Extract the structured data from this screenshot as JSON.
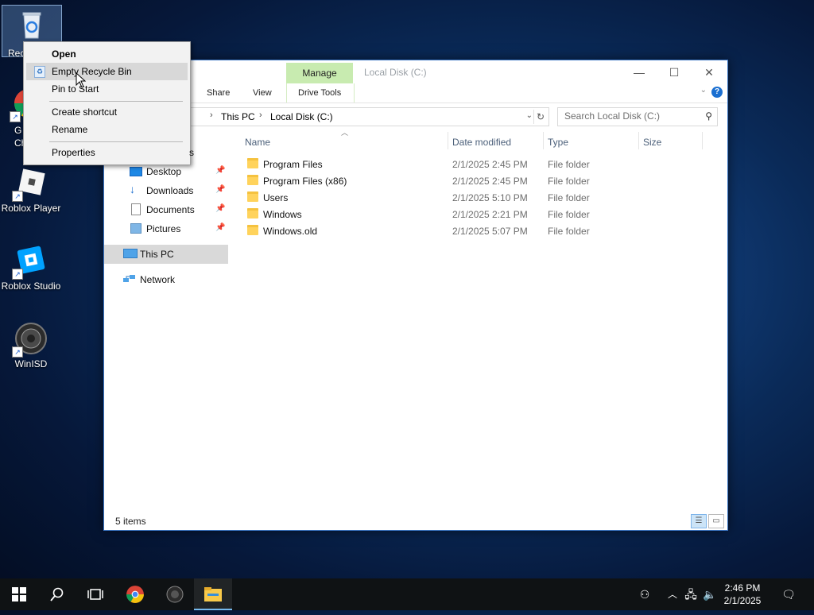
{
  "desktop": {
    "icons": [
      {
        "label": "Rec",
        "icon": "recycle-bin-icon"
      },
      {
        "label": "G\nCh",
        "icon": "chrome-icon"
      },
      {
        "label": "Roblox Player",
        "icon": "roblox-player-icon"
      },
      {
        "label": "Roblox Studio",
        "icon": "roblox-studio-icon"
      },
      {
        "label": "WinISD",
        "icon": "speaker-icon"
      }
    ]
  },
  "context_menu": {
    "items": [
      {
        "label": "Open",
        "bold": true
      },
      {
        "label": "Empty Recycle Bin",
        "hovered": true,
        "icon": "recycle-shield-icon"
      },
      {
        "label": "Pin to Start"
      },
      {
        "label": "Create shortcut"
      },
      {
        "label": "Rename"
      },
      {
        "label": "Properties"
      }
    ],
    "partial_hidden_text": "s"
  },
  "window": {
    "title": "Local Disk (C:)",
    "context_tab": "Manage",
    "ribbon_tabs": [
      "Share",
      "View",
      "Drive Tools"
    ],
    "address": {
      "root": "This PC",
      "current": "Local Disk (C:)"
    },
    "search_placeholder": "Search Local Disk (C:)",
    "nav": {
      "quick_access": [
        {
          "label": "Desktop",
          "pinned": true,
          "icon": "desktop-icon"
        },
        {
          "label": "Downloads",
          "pinned": true,
          "icon": "download-icon"
        },
        {
          "label": "Documents",
          "pinned": true,
          "icon": "document-icon"
        },
        {
          "label": "Pictures",
          "pinned": true,
          "icon": "picture-icon"
        }
      ],
      "this_pc": "This PC",
      "network": "Network"
    },
    "columns": [
      "Name",
      "Date modified",
      "Type",
      "Size"
    ],
    "files": [
      {
        "name": "Program Files",
        "date": "2/1/2025 2:45 PM",
        "type": "File folder"
      },
      {
        "name": "Program Files (x86)",
        "date": "2/1/2025 2:45 PM",
        "type": "File folder"
      },
      {
        "name": "Users",
        "date": "2/1/2025 5:10 PM",
        "type": "File folder"
      },
      {
        "name": "Windows",
        "date": "2/1/2025 2:21 PM",
        "type": "File folder"
      },
      {
        "name": "Windows.old",
        "date": "2/1/2025 5:07 PM",
        "type": "File folder"
      }
    ],
    "status": "5 items"
  },
  "taskbar": {
    "time": "2:46 PM",
    "date": "2/1/2025",
    "apps": [
      "start-icon",
      "search-icon",
      "task-view-icon",
      "chrome-icon",
      "winisd-icon",
      "file-explorer-icon"
    ]
  },
  "colors": {
    "manage_tab": "#c8ebb0",
    "selection": "#d9d9d9",
    "accent": "#1a6fd1",
    "folder": "#ffd35c"
  }
}
